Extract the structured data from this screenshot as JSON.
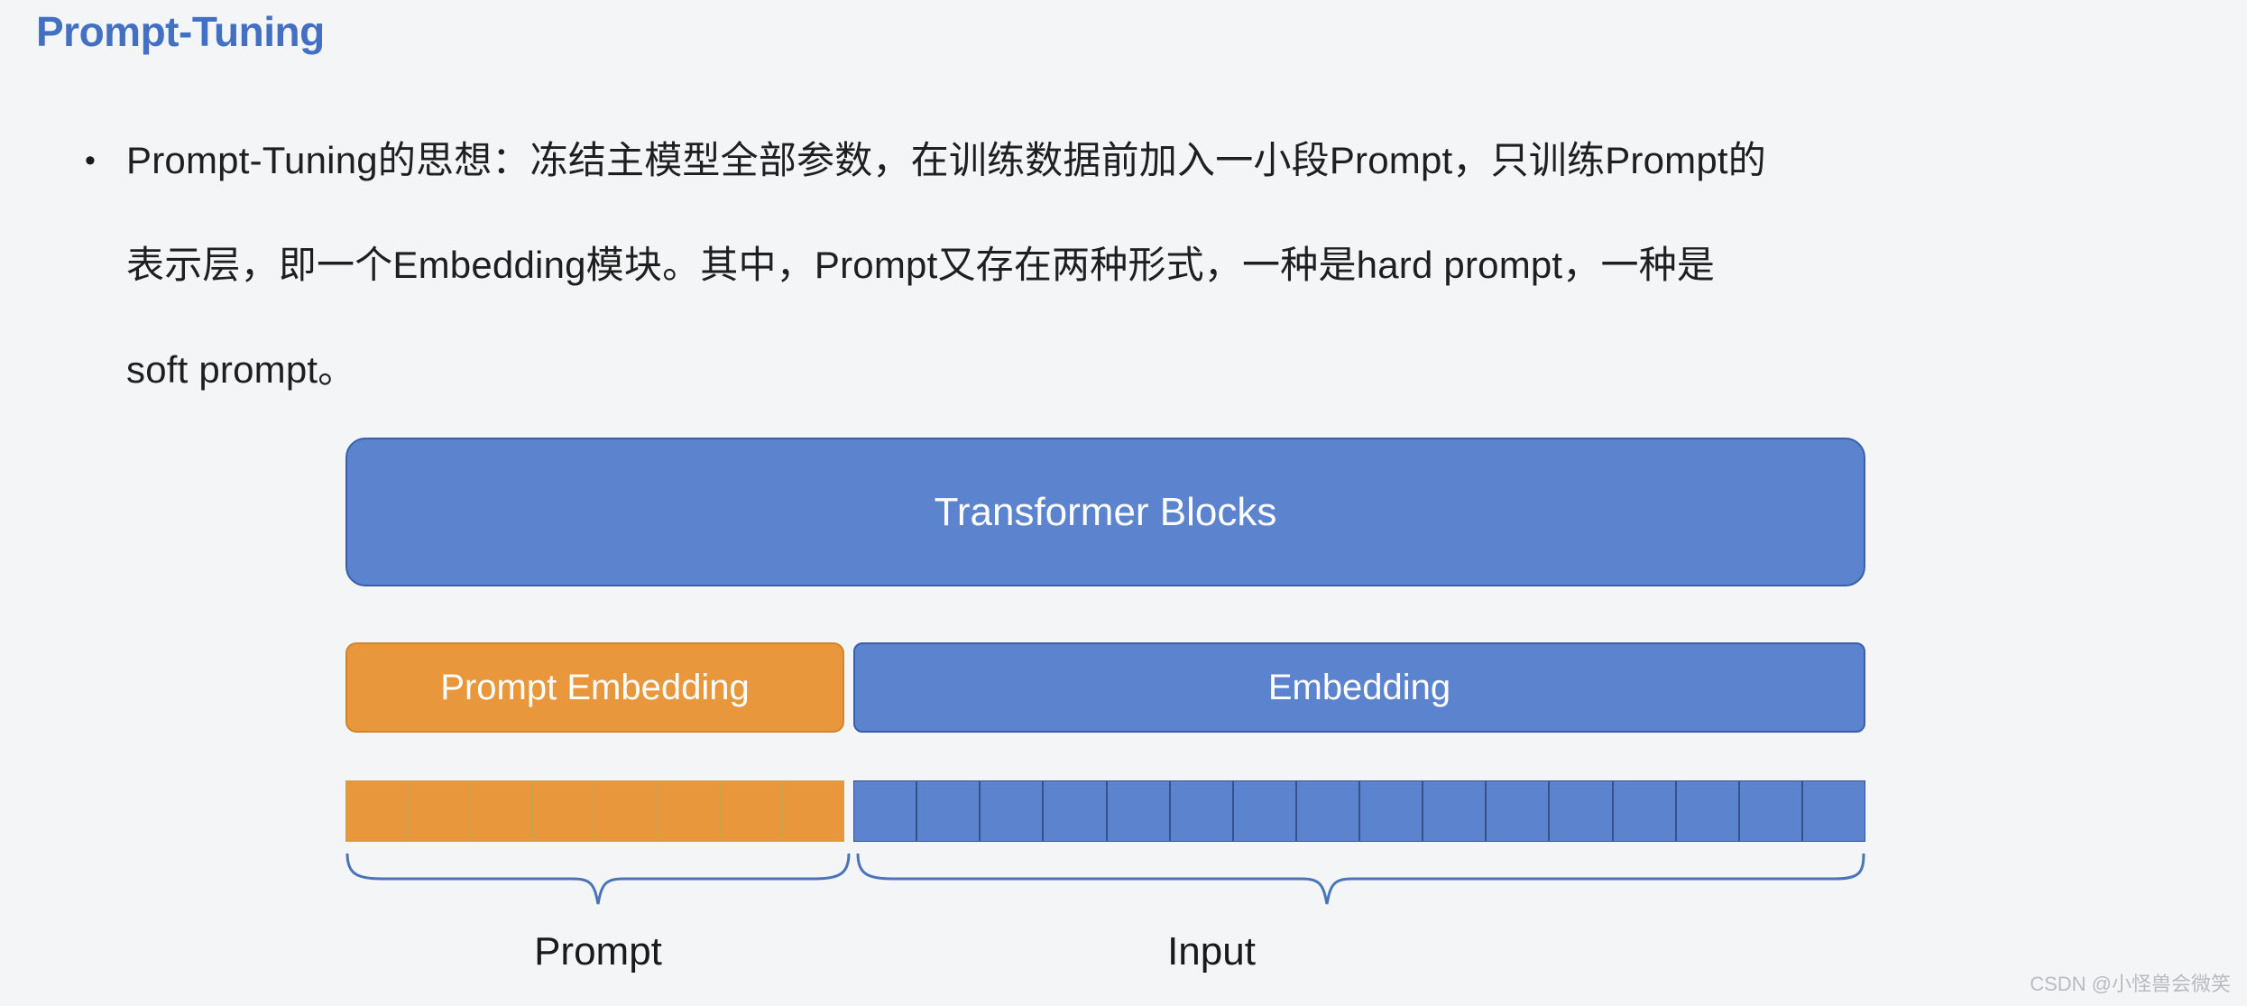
{
  "slide": {
    "title": "Prompt-Tuning",
    "bullet_marker": "•",
    "body_lines": [
      "Prompt-Tuning的思想：冻结主模型全部参数，在训练数据前加入一小段Prompt，只训练Prompt的",
      "表示层，即一个Embedding模块。其中，Prompt又存在两种形式，一种是hard prompt，一种是",
      "soft prompt。"
    ]
  },
  "diagram": {
    "transformer_block_label": "Transformer Blocks",
    "prompt_embedding_label": "Prompt Embedding",
    "embedding_label": "Embedding",
    "brace_labels": {
      "prompt": "Prompt",
      "input": "Input"
    },
    "tokens": {
      "prompt_count": 8,
      "input_count": 16
    }
  },
  "colors": {
    "title_blue": "#4470c4",
    "block_blue": "#5b83ce",
    "block_blue_border": "#3a5fa8",
    "prompt_orange": "#e8973c",
    "prompt_orange_border": "#d08628",
    "brace_blue": "#4a74b8",
    "background": "#f4f5f7",
    "body_text": "#1f1f1f",
    "watermark_gray": "#b7bbc2"
  },
  "watermark": {
    "text": "CSDN @小怪兽会微笑"
  }
}
